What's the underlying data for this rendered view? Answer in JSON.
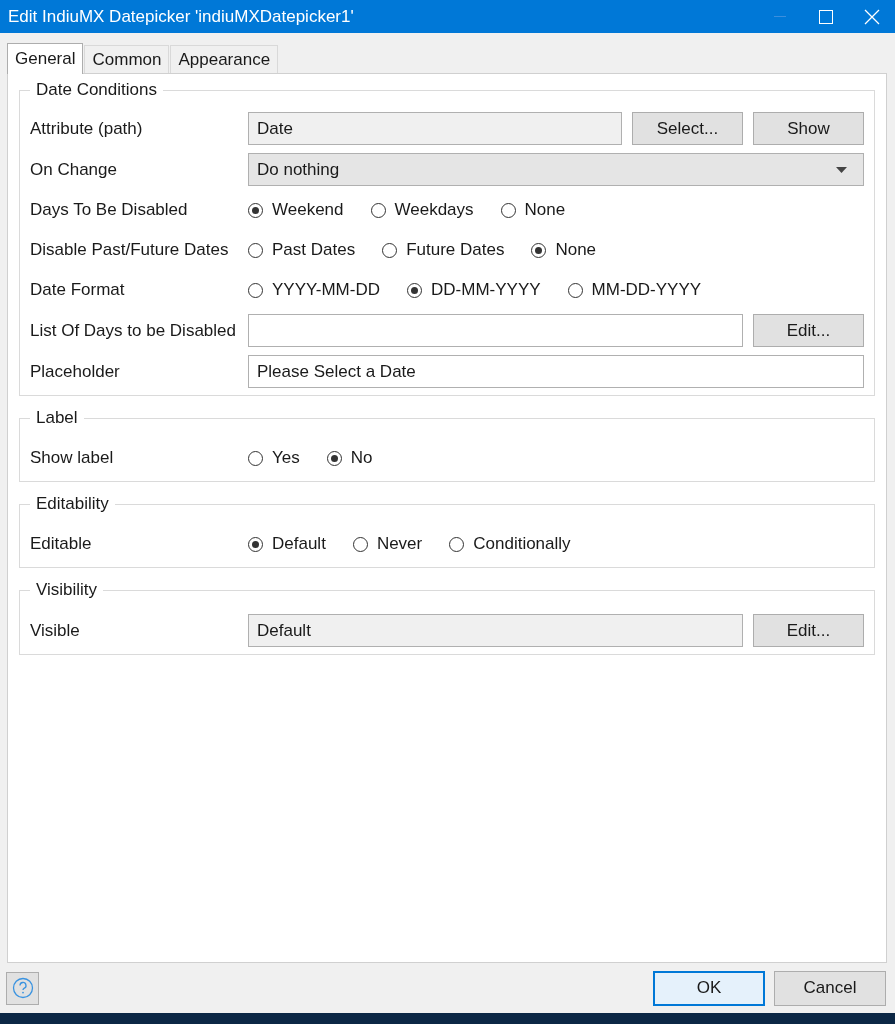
{
  "window": {
    "title": "Edit IndiuMX Datepicker 'indiuMXDatepicker1'"
  },
  "tabs": [
    {
      "label": "General",
      "selected": true
    },
    {
      "label": "Common",
      "selected": false
    },
    {
      "label": "Appearance",
      "selected": false
    }
  ],
  "groups": [
    {
      "title": "Date Conditions",
      "rows": [
        {
          "kind": "field",
          "label": "Attribute (path)",
          "value": "Date",
          "buttons": [
            "Select...",
            "Show"
          ]
        },
        {
          "kind": "dropdown",
          "label": "On Change",
          "value": "Do nothing"
        },
        {
          "kind": "radio",
          "label": "Days To Be Disabled",
          "options": [
            {
              "label": "Weekend",
              "selected": true
            },
            {
              "label": "Weekdays",
              "selected": false
            },
            {
              "label": "None",
              "selected": false
            }
          ]
        },
        {
          "kind": "radio",
          "label": "Disable Past/Future Dates",
          "options": [
            {
              "label": "Past Dates",
              "selected": false
            },
            {
              "label": "Future Dates",
              "selected": false
            },
            {
              "label": "None",
              "selected": true
            }
          ]
        },
        {
          "kind": "radio",
          "label": "Date Format",
          "options": [
            {
              "label": "YYYY-MM-DD",
              "selected": false
            },
            {
              "label": "DD-MM-YYYY",
              "selected": true
            },
            {
              "label": "MM-DD-YYYY",
              "selected": false
            }
          ]
        },
        {
          "kind": "input",
          "label": "List Of Days to be Disabled",
          "value": "",
          "buttons": [
            "Edit..."
          ]
        },
        {
          "kind": "input",
          "label": "Placeholder",
          "value": "Please Select a Date"
        }
      ]
    },
    {
      "title": "Label",
      "rows": [
        {
          "kind": "radio",
          "label": "Show label",
          "options": [
            {
              "label": "Yes",
              "selected": false
            },
            {
              "label": "No",
              "selected": true
            }
          ]
        }
      ]
    },
    {
      "title": "Editability",
      "rows": [
        {
          "kind": "radio",
          "label": "Editable",
          "options": [
            {
              "label": "Default",
              "selected": true
            },
            {
              "label": "Never",
              "selected": false
            },
            {
              "label": "Conditionally",
              "selected": false
            }
          ]
        }
      ]
    },
    {
      "title": "Visibility",
      "rows": [
        {
          "kind": "field",
          "label": "Visible",
          "value": "Default",
          "buttons": [
            "Edit..."
          ]
        }
      ]
    }
  ],
  "footer": {
    "buttons": [
      {
        "label": "OK",
        "default": true
      },
      {
        "label": "Cancel",
        "default": false
      }
    ]
  }
}
